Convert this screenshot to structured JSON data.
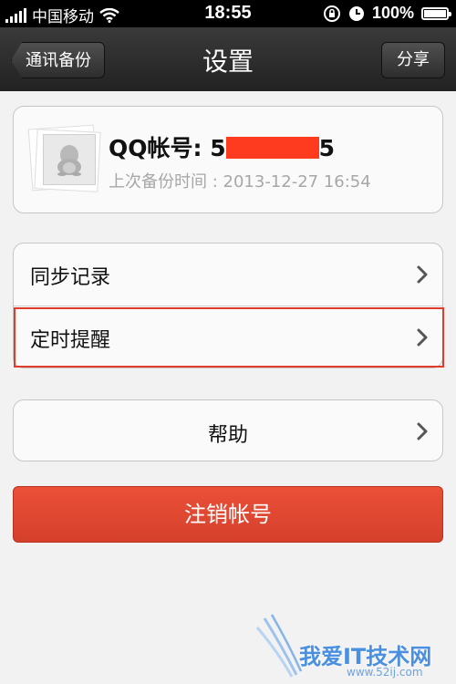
{
  "status_bar": {
    "carrier": "中国移动",
    "time": "18:55",
    "battery": "100%",
    "battery_level": 1.0,
    "icons": [
      "signal-icon",
      "wifi-icon",
      "rotation-lock-icon",
      "alarm-icon",
      "battery-icon"
    ]
  },
  "nav": {
    "title": "设置",
    "back_label": "通讯备份",
    "share_label": "分享"
  },
  "account": {
    "label_prefix": "QQ帐号: 5",
    "label_suffix": "5",
    "backup_time": "上次备份时间 : 2013-12-27 16:54"
  },
  "menu": {
    "items": [
      {
        "label": "同步记录"
      },
      {
        "label": "定时提醒"
      }
    ]
  },
  "help": {
    "label": "帮助"
  },
  "logout": {
    "label": "注销帐号"
  },
  "watermark": {
    "text": "我爱IT技术网",
    "url": "www.52ij.com"
  },
  "colors": {
    "logout_bg": "#e34a33",
    "highlight_border": "#e23b2a",
    "redaction": "#ff3b1f",
    "nav_bg": "#2a2a2a"
  }
}
